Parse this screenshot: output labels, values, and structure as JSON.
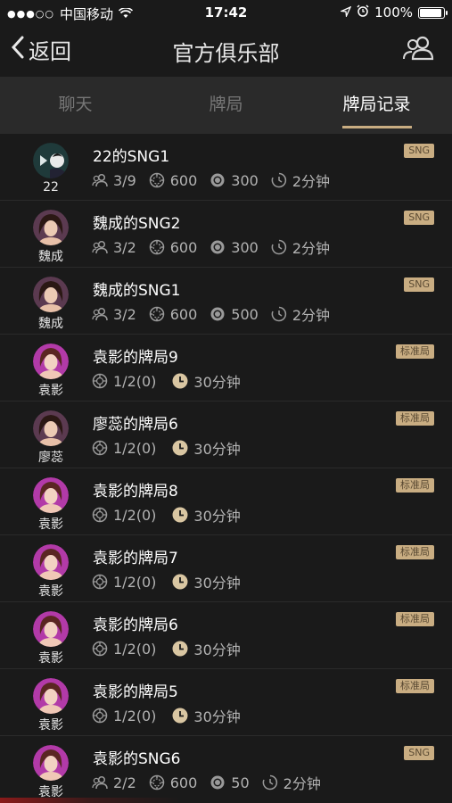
{
  "status_bar": {
    "signal": "●●●○○",
    "carrier": "中国移动",
    "time": "17:42",
    "battery": "100%"
  },
  "nav": {
    "back_label": "返回",
    "title": "官方俱乐部"
  },
  "tabs": [
    {
      "label": "聊天",
      "active": false
    },
    {
      "label": "牌局",
      "active": false
    },
    {
      "label": "牌局记录",
      "active": true
    }
  ],
  "records": [
    {
      "title": "22的SNG1",
      "owner": "22",
      "badge": "SNG",
      "type": "sng",
      "players": "3/9",
      "chips": "600",
      "blind": "300",
      "time": "2分钟",
      "avatar": "club"
    },
    {
      "title": "魏成的SNG2",
      "owner": "魏成",
      "badge": "SNG",
      "type": "sng",
      "players": "3/2",
      "chips": "600",
      "blind": "300",
      "time": "2分钟",
      "avatar": "brown"
    },
    {
      "title": "魏成的SNG1",
      "owner": "魏成",
      "badge": "SNG",
      "type": "sng",
      "players": "3/2",
      "chips": "600",
      "blind": "500",
      "time": "2分钟",
      "avatar": "brown"
    },
    {
      "title": "袁影的牌局9",
      "owner": "袁影",
      "badge": "标准局",
      "type": "std",
      "blinds": "1/2(0)",
      "time": "30分钟",
      "avatar": "pink"
    },
    {
      "title": "廖蕊的牌局6",
      "owner": "廖蕊",
      "badge": "标准局",
      "type": "std",
      "blinds": "1/2(0)",
      "time": "30分钟",
      "avatar": "brown"
    },
    {
      "title": "袁影的牌局8",
      "owner": "袁影",
      "badge": "标准局",
      "type": "std",
      "blinds": "1/2(0)",
      "time": "30分钟",
      "avatar": "pink"
    },
    {
      "title": "袁影的牌局7",
      "owner": "袁影",
      "badge": "标准局",
      "type": "std",
      "blinds": "1/2(0)",
      "time": "30分钟",
      "avatar": "pink"
    },
    {
      "title": "袁影的牌局6",
      "owner": "袁影",
      "badge": "标准局",
      "type": "std",
      "blinds": "1/2(0)",
      "time": "30分钟",
      "avatar": "pink"
    },
    {
      "title": "袁影的牌局5",
      "owner": "袁影",
      "badge": "标准局",
      "type": "std",
      "blinds": "1/2(0)",
      "time": "30分钟",
      "avatar": "pink"
    },
    {
      "title": "袁影的SNG6",
      "owner": "袁影",
      "badge": "SNG",
      "type": "sng",
      "players": "2/2",
      "chips": "600",
      "blind": "50",
      "time": "2分钟",
      "avatar": "pink"
    }
  ],
  "colors": {
    "background": "#1a1a1a",
    "tab_bar": "#2a2a2a",
    "accent": "#c9ad82",
    "muted_text": "#b3b3b3"
  }
}
